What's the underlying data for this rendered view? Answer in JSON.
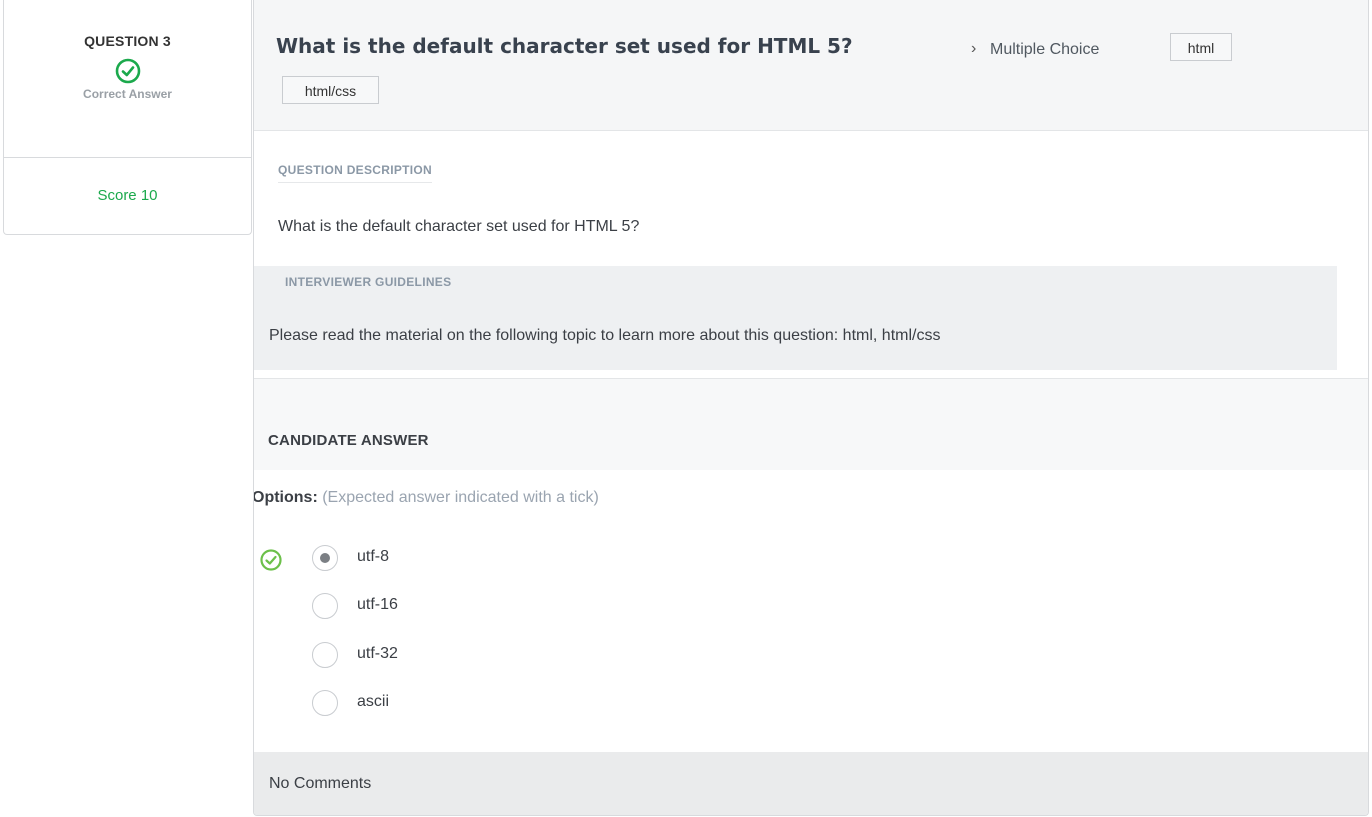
{
  "sidebar": {
    "question_label": "QUESTION 3",
    "status_label": "Correct Answer",
    "score_label": "Score 10",
    "status_icon": "check-circle-icon"
  },
  "header": {
    "title": "What is the default character set used for HTML 5?",
    "separator_icon": "chevron-right-icon",
    "type": "Multiple Choice",
    "tags": [
      "html",
      "html/css"
    ]
  },
  "description": {
    "label": "QUESTION DESCRIPTION",
    "text": "What is the default character set used for HTML 5?"
  },
  "guidelines": {
    "label": "INTERVIEWER GUIDELINES",
    "text": "Please read the material on the following topic to learn more about this question: html, html/css"
  },
  "candidate": {
    "label": "CANDIDATE ANSWER",
    "options_label": "Options:",
    "options_hint": "(Expected answer indicated with a tick)",
    "options": [
      {
        "label": "utf-8",
        "selected": true,
        "expected": true
      },
      {
        "label": "utf-16",
        "selected": false,
        "expected": false
      },
      {
        "label": "utf-32",
        "selected": false,
        "expected": false
      },
      {
        "label": "ascii",
        "selected": false,
        "expected": false
      }
    ]
  },
  "comments": {
    "text": "No Comments"
  },
  "colors": {
    "correct_green": "#1ba94c",
    "tick_green": "#6cc04a"
  }
}
